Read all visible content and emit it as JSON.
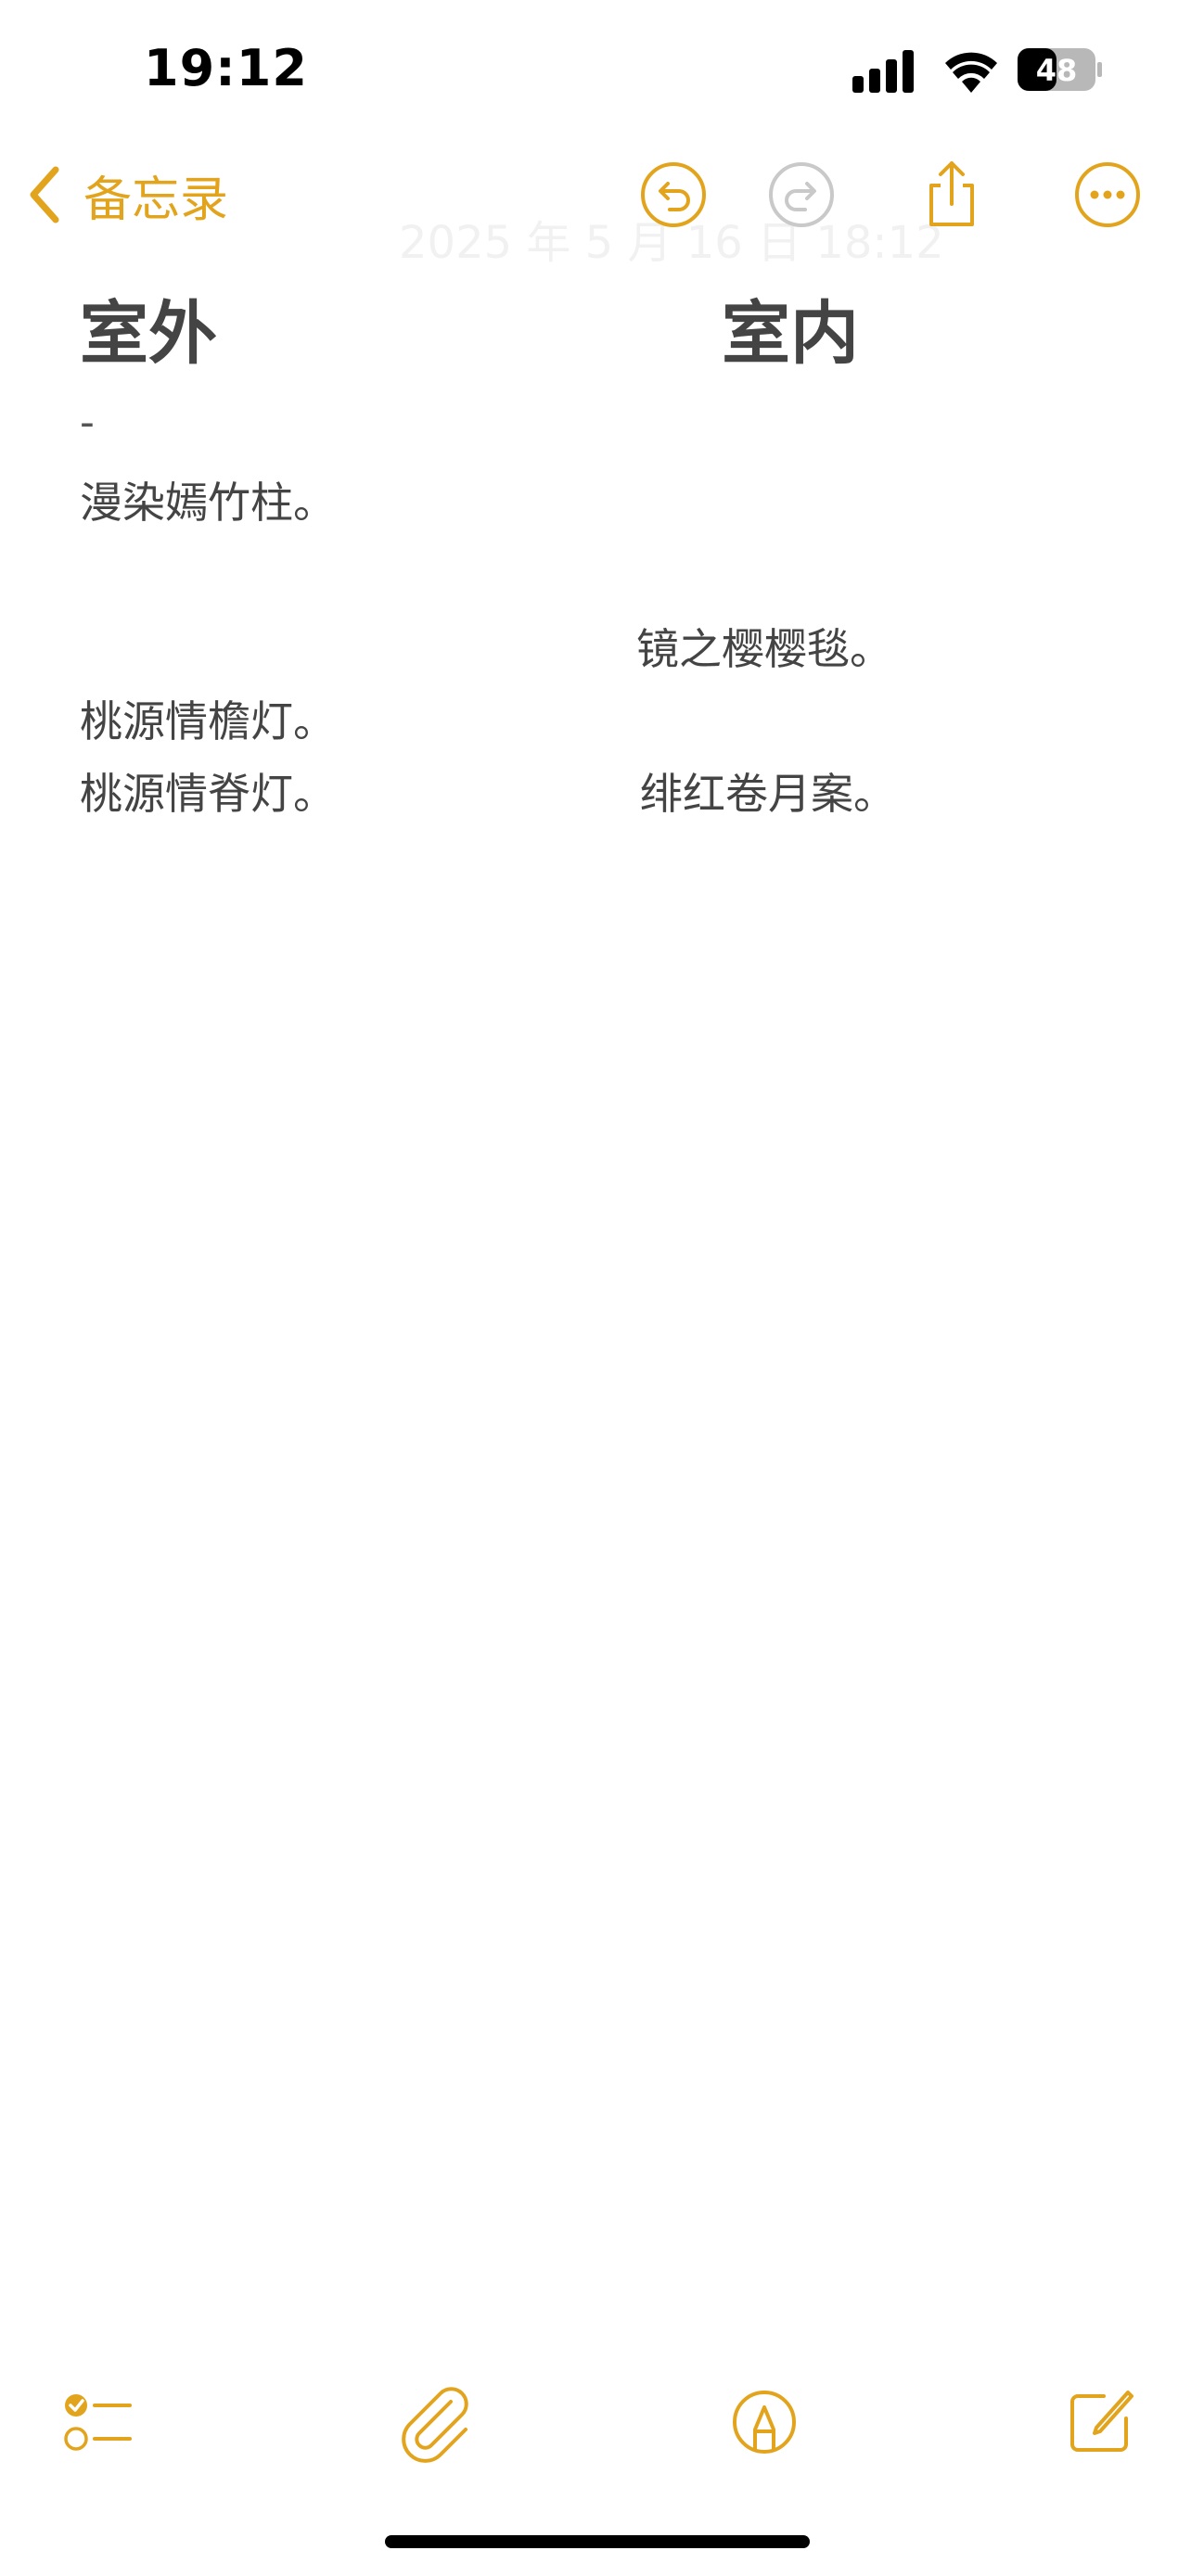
{
  "status_bar": {
    "time": "19:12",
    "battery": "48"
  },
  "nav": {
    "back_label": "备忘录",
    "date_ghost": "2025 年 5 月 16 日 18:12"
  },
  "note": {
    "left_heading": "室外",
    "right_heading": "室内",
    "dash": "-",
    "lines": {
      "l1": "漫染嫣竹柱。",
      "r1": "镜之樱樱毯。",
      "l2": "桃源情檐灯。",
      "l3": "桃源情脊灯。",
      "r2": "绯红卷月案。"
    }
  },
  "colors": {
    "accent": "#e3a41d",
    "text": "#444444"
  }
}
